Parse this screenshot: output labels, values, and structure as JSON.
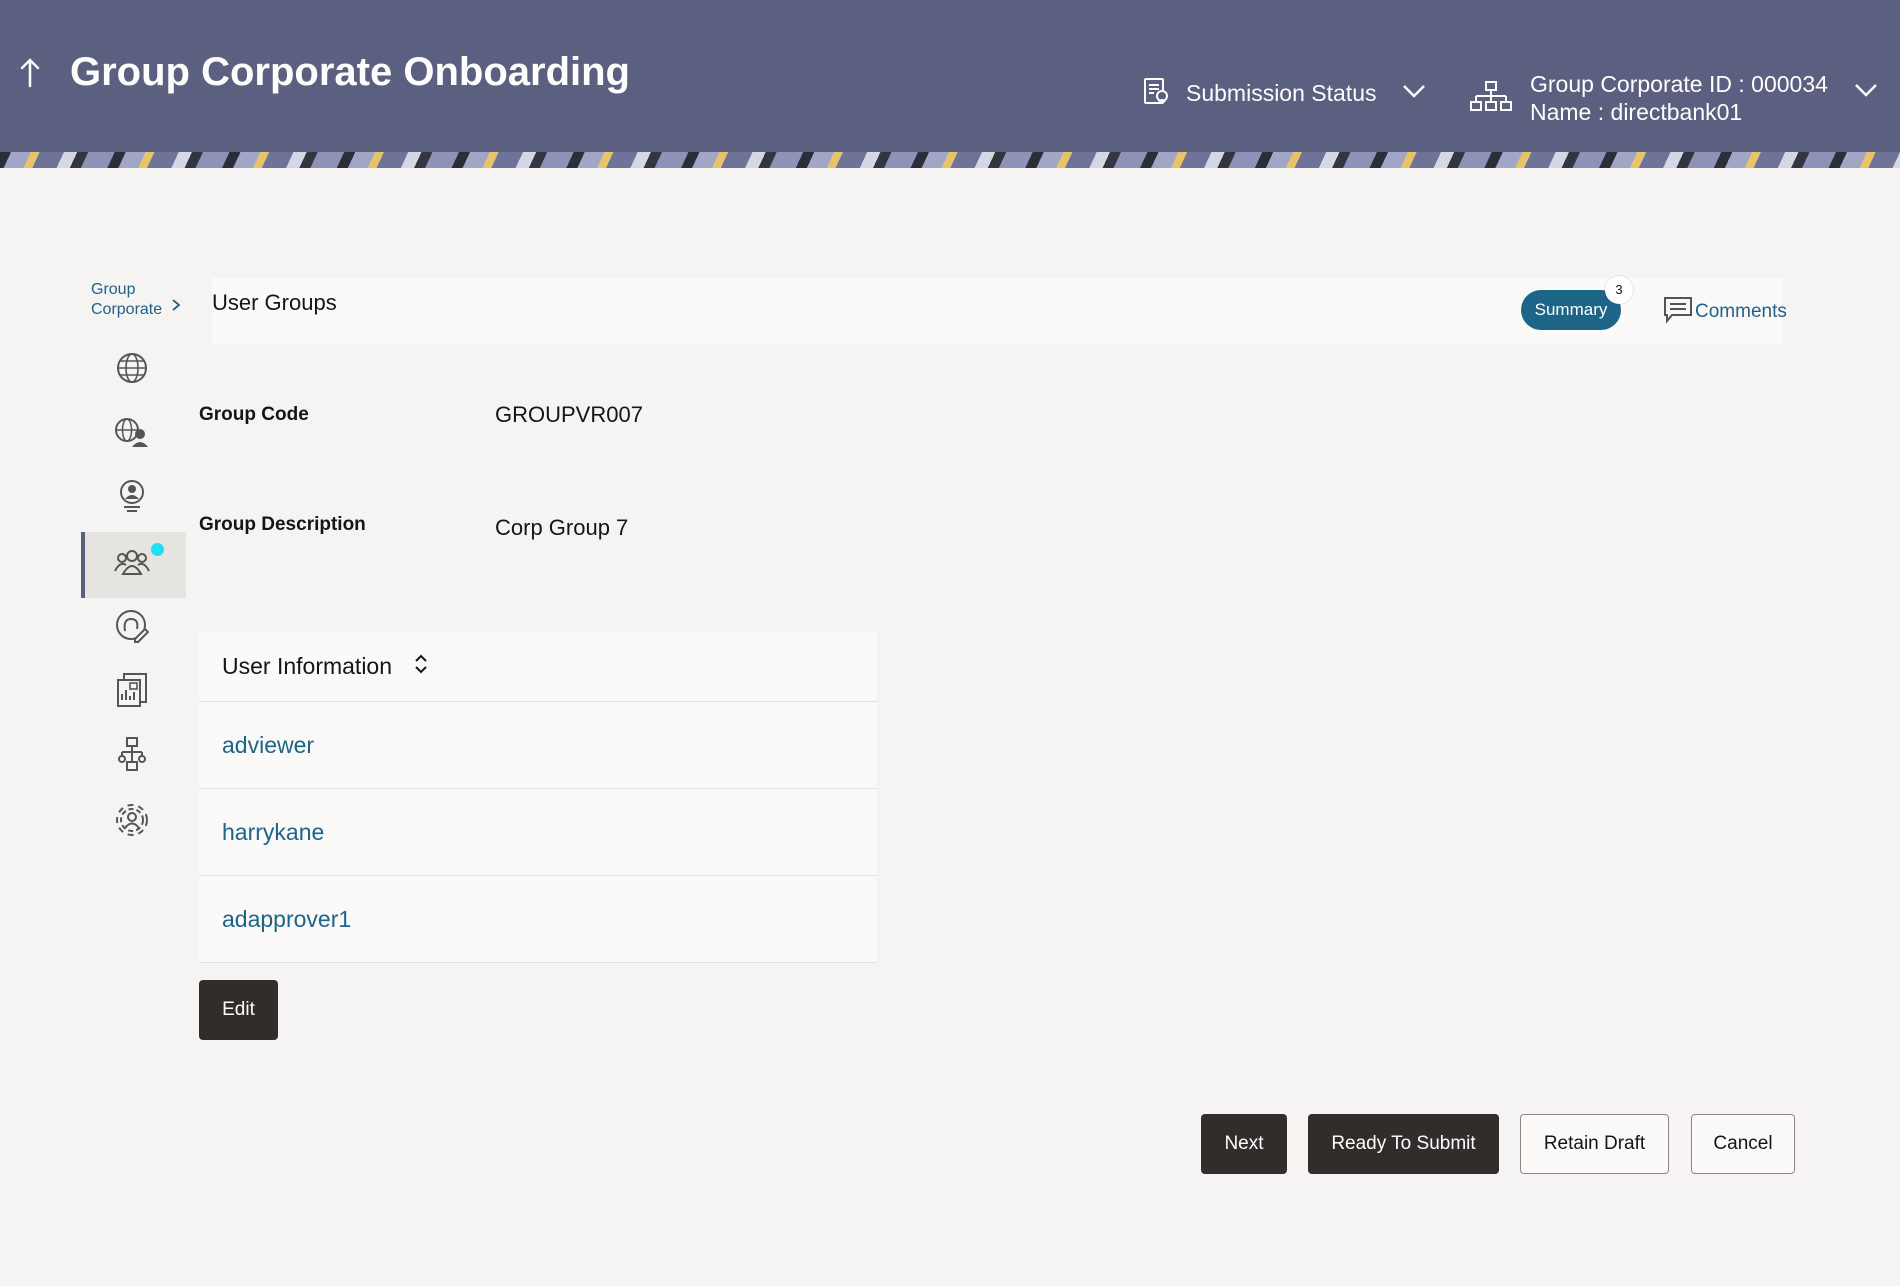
{
  "header": {
    "back_icon": "arrow-up-icon",
    "title": "Group Corporate Onboarding",
    "submission_status": "Submission Status",
    "corporate_id": "Group Corporate ID : 000034",
    "corporate_name": "Name : directbank01"
  },
  "sidebar": {
    "breadcrumb_line1": "Group",
    "breadcrumb_line2": "Corporate",
    "items": [
      {
        "icon": "globe-icon"
      },
      {
        "icon": "globe-users-icon"
      },
      {
        "icon": "user-profile-icon"
      },
      {
        "icon": "user-groups-icon",
        "active": true
      },
      {
        "icon": "user-edit-icon"
      },
      {
        "icon": "reports-icon"
      },
      {
        "icon": "workflow-icon"
      },
      {
        "icon": "settings-users-icon"
      }
    ]
  },
  "section": {
    "title": "User Groups",
    "summary_label": "Summary",
    "summary_count": "3",
    "comments_label": "Comments"
  },
  "fields": {
    "group_code_label": "Group Code",
    "group_code_value": "GROUPVR007",
    "group_desc_label": "Group Description",
    "group_desc_value": "Corp Group 7"
  },
  "table": {
    "header": "User Information",
    "rows": [
      "adviewer",
      "harrykane",
      "adapprover1"
    ]
  },
  "buttons": {
    "edit": "Edit",
    "next": "Next",
    "ready": "Ready To Submit",
    "retain": "Retain Draft",
    "cancel": "Cancel"
  }
}
